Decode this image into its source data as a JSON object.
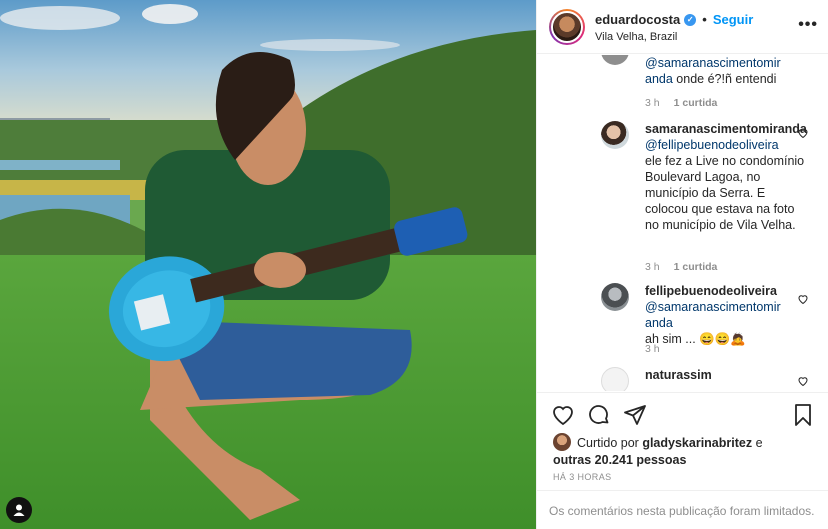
{
  "post": {
    "username": "eduardocosta",
    "follow_label": "Seguir",
    "location": "Vila Velha, Brazil",
    "more_label": "•••"
  },
  "comments": [
    {
      "mention": "@samaranascimentomir anda",
      "text": "onde é?!ñ entendi",
      "time": "3 h",
      "likes": "1 curtida"
    },
    {
      "user": "samaranascimentomiranda",
      "mention": "@fellipebuenodeoliveira",
      "text": "ele fez a Live no condomínio Boulevard Lagoa, no município da Serra. E colocou que estava na foto no município de Vila Velha.",
      "time": "3 h",
      "likes": "1 curtida"
    },
    {
      "user": "fellipebuenodeoliveira",
      "mention": "@samaranascimentomir anda",
      "text": "ah sim ... 😄😄🙇",
      "time": "3 h"
    },
    {
      "user": "naturassim",
      "text": ""
    }
  ],
  "likes": {
    "prefix": "Curtido por",
    "user": "gladyskarinabritez",
    "mid": "e",
    "others": "outras 20.241 pessoas"
  },
  "time_ago": "HÁ 3 HORAS",
  "comments_limited": "Os comentários nesta publicação foram limitados.",
  "icons": [
    "heart-icon",
    "comment-icon",
    "share-icon",
    "bookmark-icon",
    "verified-icon",
    "user-tag-icon"
  ],
  "colors": {
    "accent": "#0095f6",
    "verified": "#3897f0",
    "meta": "#8e8e8e",
    "mention": "#00376b"
  }
}
